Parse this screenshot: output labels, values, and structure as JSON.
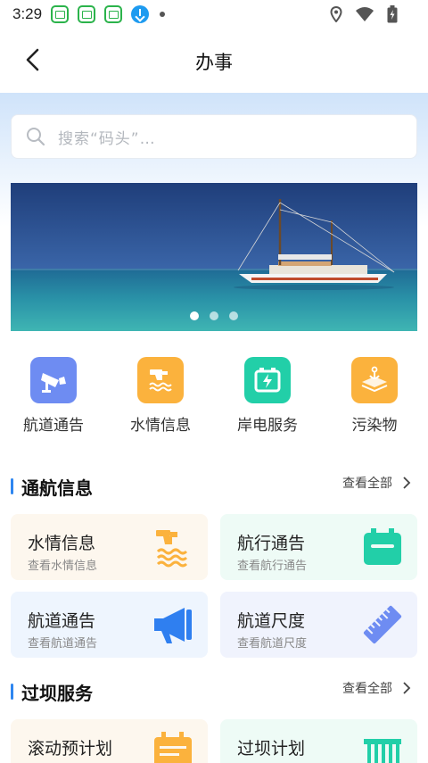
{
  "status_bar": {
    "time": "3:29",
    "icons": [
      "app-notification-icon",
      "app-notification-icon",
      "app-notification-icon",
      "download-icon",
      "more-dot-icon",
      "location-icon",
      "wifi-icon",
      "battery-icon"
    ]
  },
  "header": {
    "title": "办事",
    "back_icon": "chevron-left-icon"
  },
  "search": {
    "placeholder": "搜索“码头”…",
    "icon": "search-icon"
  },
  "banner": {
    "image": "sailboat-at-sea",
    "slide_count": 3,
    "active_slide": 1
  },
  "quick_actions": [
    {
      "label": "航道通告",
      "icon": "camera-icon",
      "color": "#6e8cf2"
    },
    {
      "label": "水情信息",
      "icon": "water-tap-icon",
      "color": "#fbb23d"
    },
    {
      "label": "岸电服务",
      "icon": "battery-charge-icon",
      "color": "#22cfa8"
    },
    {
      "label": "污染物",
      "icon": "layers-anchor-icon",
      "color": "#fbb23d"
    }
  ],
  "navigation_info": {
    "title": "通航信息",
    "more_label": "查看全部",
    "cards": [
      {
        "title": "水情信息",
        "subtitle": "查看水情信息",
        "icon": "water-tap-icon"
      },
      {
        "title": "航行通告",
        "subtitle": "查看航行通告",
        "icon": "notice-board-icon"
      },
      {
        "title": "航道通告",
        "subtitle": "查看航道通告",
        "icon": "megaphone-icon"
      },
      {
        "title": "航道尺度",
        "subtitle": "查看航道尺度",
        "icon": "ruler-icon"
      }
    ]
  },
  "dam_service": {
    "title": "过坝服务",
    "more_label": "查看全部",
    "cards": [
      {
        "title": "滚动预计划",
        "icon": "calendar-icon"
      },
      {
        "title": "过坝计划",
        "icon": "dam-gate-icon"
      }
    ]
  },
  "colors": {
    "accent": "#2e86f0",
    "orange": "#fbb23d",
    "teal": "#22cfa8",
    "blue": "#2f7ff0",
    "purple_blue": "#6e8cf2"
  }
}
